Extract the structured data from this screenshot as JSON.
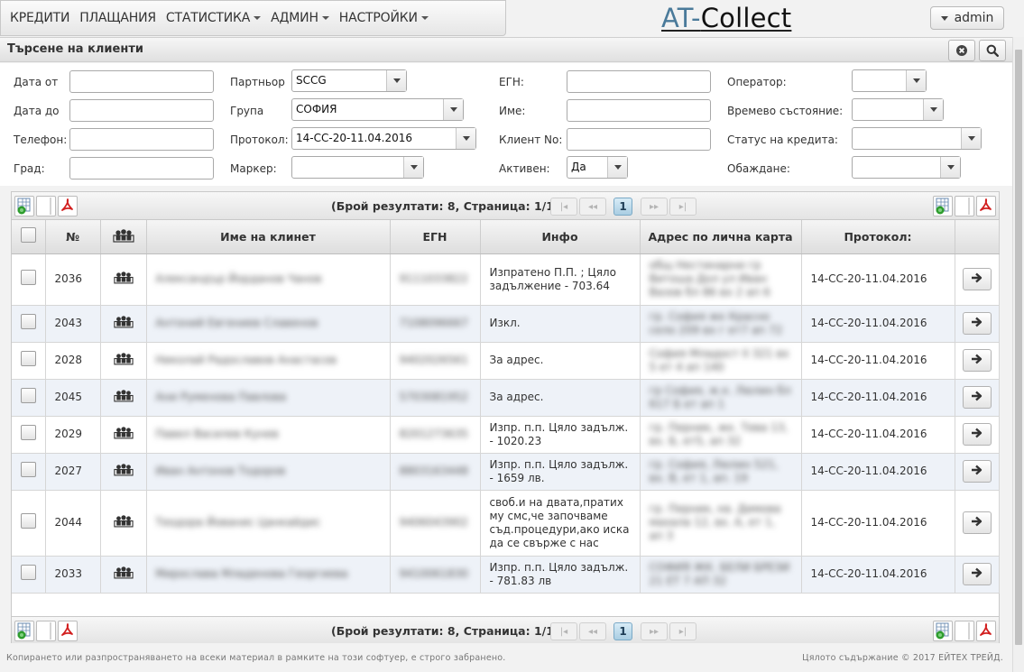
{
  "menu": [
    {
      "label": "КРЕДИТИ",
      "caret": false
    },
    {
      "label": "ПЛАЩАНИЯ",
      "caret": false
    },
    {
      "label": "СТАТИСТИКА",
      "caret": true
    },
    {
      "label": "АДМИН",
      "caret": true
    },
    {
      "label": "НАСТРОЙКИ",
      "caret": true
    }
  ],
  "logo": {
    "prefix": "AT-",
    "name": "Collect"
  },
  "user": {
    "label": "admin"
  },
  "panel": {
    "title": "Търсене на клиенти"
  },
  "filters": {
    "date_from": {
      "label": "Дата от",
      "value": ""
    },
    "date_to": {
      "label": "Дата до",
      "value": ""
    },
    "phone": {
      "label": "Телефон:",
      "value": ""
    },
    "city": {
      "label": "Град:",
      "value": ""
    },
    "partner": {
      "label": "Партньор",
      "value": "SCCG"
    },
    "group": {
      "label": "Група",
      "value": "СОФИЯ"
    },
    "protocol": {
      "label": "Протокол:",
      "value": "14-СС-20-11.04.2016"
    },
    "marker": {
      "label": "Маркер:",
      "value": ""
    },
    "egn": {
      "label": "ЕГН:",
      "value": ""
    },
    "name": {
      "label": "Име:",
      "value": ""
    },
    "client_no": {
      "label": "Клиент No:",
      "value": ""
    },
    "active": {
      "label": "Активен:",
      "value": "Да"
    },
    "operator": {
      "label": "Оператор:",
      "value": ""
    },
    "temp_state": {
      "label": "Времево състояние:",
      "value": ""
    },
    "credit_status": {
      "label": "Статус на кредита:",
      "value": ""
    },
    "call": {
      "label": "Обаждане:",
      "value": ""
    }
  },
  "pager": {
    "summary": "(Брой резултати: 8, Страница: 1/1)",
    "current_page": "1"
  },
  "columns": [
    "№",
    "Име на клинет",
    "ЕГН",
    "Инфо",
    "Адрес по лична карта",
    "Протокол:"
  ],
  "rows": [
    {
      "no": "2036",
      "name": "Александър Йорданов Чанов",
      "egn": "9111033822",
      "info": "Изпратено П.П. ; Цяло задължение - 703.64",
      "address": "общ Нестинарни гр Витоша Дол ул Иван Вазов бл 86 вх 2 ап 6",
      "protocol": "14-СС-20-11.04.2016"
    },
    {
      "no": "2043",
      "name": "Антоний Евгениев Славенов",
      "egn": "7108096667",
      "info": "Изкл.",
      "address": "гр. София жк Красно село 209 вх г ет7 ап 72",
      "protocol": "14-СС-20-11.04.2016"
    },
    {
      "no": "2028",
      "name": "Николай Радославов Анастасов",
      "egn": "9402026561",
      "info": "За адрес.",
      "address": "София Младост II 321 вх 5 ет 4 ап 140",
      "protocol": "14-СС-20-11.04.2016"
    },
    {
      "no": "2045",
      "name": "Ани Руменова Павлова",
      "egn": "5703081952",
      "info": "За адрес.",
      "address": "гр София, ж.к. Люлин бл 617 Б ет ап 1",
      "protocol": "14-СС-20-11.04.2016"
    },
    {
      "no": "2029",
      "name": "Павел Василев Кунев",
      "egn": "8201273635",
      "info": "Изпр. п.п. Цяло задълж. - 1020.23",
      "address": "гр. Перник, жк. Тева 13, вх. Б, ет5, ап 32",
      "protocol": "14-СС-20-11.04.2016"
    },
    {
      "no": "2027",
      "name": "Иван Антонов Тодоров",
      "egn": "8803163448",
      "info": "Изпр. п.п. Цяло задълж. - 1659 лв.",
      "address": "гр. София, Люлин 521, вх. В, ет 1, ап. 19",
      "protocol": "14-СС-20-11.04.2016"
    },
    {
      "no": "2044",
      "name": "Теодора Йованис Цанкайдис",
      "egn": "9406043902",
      "info": "своб.и на двата,пратих му смс,че започваме съд.процедури,ако иска да се свърже с нас",
      "address": "гр. Перник, кв. Димова махала 12, вх. А, ет 1, ап 3",
      "protocol": "14-СС-20-11.04.2016"
    },
    {
      "no": "2033",
      "name": "Мирослава Младенова Георгиева",
      "egn": "9410061830",
      "info": "Изпр. п.п. Цяло задълж. - 781.83 лв",
      "address": "СОФИЯ ЖК. БЕЛИ БРЕЗИ 21 ЕТ 7 АП 32",
      "protocol": "14-СС-20-11.04.2016"
    }
  ],
  "footer": {
    "left": "Копирането или разпространяването на всеки материал в рамките на този софтуер, е строго забранено.",
    "right": "Цялото съдържание © 2017 ЕЙТЕХ ТРЕЙД."
  }
}
